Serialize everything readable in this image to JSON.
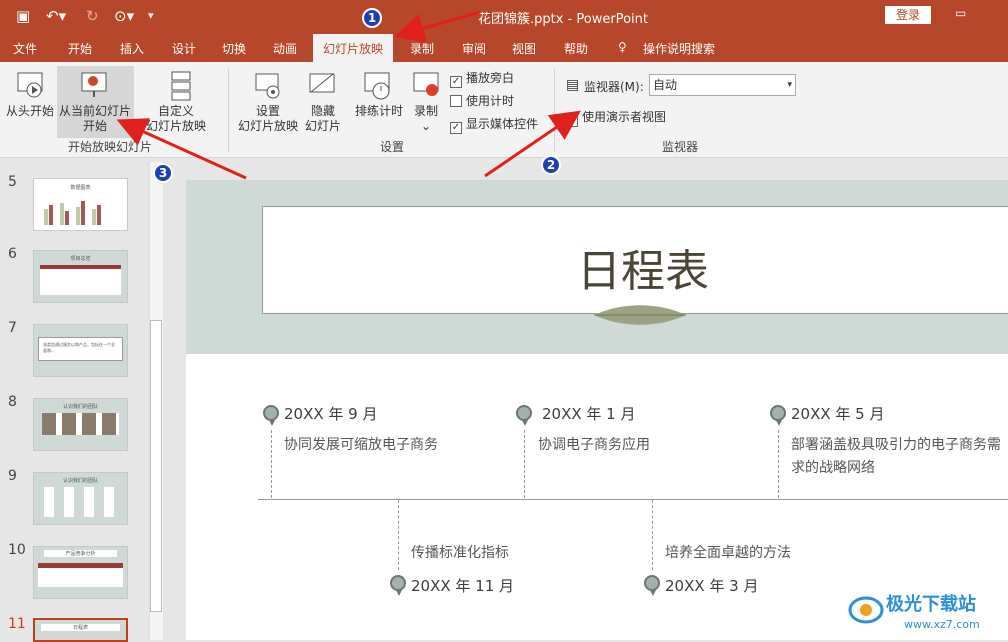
{
  "titlebar": {
    "doc_title": "花团锦簇.pptx  -  PowerPoint",
    "login": "登录"
  },
  "tabs": [
    "文件",
    "开始",
    "插入",
    "设计",
    "切换",
    "动画",
    "幻灯片放映",
    "录制",
    "审阅",
    "视图",
    "帮助",
    "操作说明搜索"
  ],
  "active_tab": "幻灯片放映",
  "ribbon": {
    "from_beginning": "从头开始",
    "from_current_1": "从当前幻灯片",
    "from_current_2": "开始",
    "custom_1": "自定义",
    "custom_2": "幻灯片放映",
    "group_start": "开始放映幻灯片",
    "setup_1": "设置",
    "setup_2": "幻灯片放映",
    "hide_1": "隐藏",
    "hide_2": "幻灯片",
    "rehearse": "排练计时",
    "record": "录制",
    "play_narration": "播放旁白",
    "use_timings": "使用计时",
    "show_media": "显示媒体控件",
    "group_setup": "设置",
    "monitor_label": "监视器(M):",
    "monitor_value": "自动",
    "presenter_view": "使用演示者视图",
    "group_monitors": "监视器"
  },
  "checkboxes": {
    "play_narration": true,
    "use_timings": false,
    "show_media": true,
    "presenter_view": true
  },
  "thumbs": [
    {
      "num": "5",
      "caption": "数据图表"
    },
    {
      "num": "6",
      "caption": "项目总览"
    },
    {
      "num": "7",
      "caption": "该类型通过服务以和产品，包括在一个全面和..."
    },
    {
      "num": "8",
      "caption": "认识我们的团队"
    },
    {
      "num": "9",
      "caption": "认识我们的团队"
    },
    {
      "num": "10",
      "caption": "产品竞争分析"
    },
    {
      "num": "11",
      "caption": "日程表"
    }
  ],
  "slide": {
    "title": "日程表",
    "top": [
      {
        "date": "20XX 年 9 月",
        "desc": "协同发展可缩放电子商务"
      },
      {
        "date": "20XX 年 1 月",
        "desc": "协调电子商务应用"
      },
      {
        "date": "20XX 年 5 月",
        "desc": "部署涵盖极具吸引力的电子商务需求的战略网络"
      }
    ],
    "bottom": [
      {
        "date": "20XX 年 11 月",
        "desc": "传播标准化指标"
      },
      {
        "date": "20XX 年 3 月",
        "desc": "培养全面卓越的方法"
      }
    ]
  },
  "badges": [
    "1",
    "2",
    "3"
  ],
  "watermark": {
    "text": "极光下载站",
    "url": "www.xz7.com"
  },
  "colors": {
    "accent": "#b7472a",
    "badge": "#1e3fb0",
    "arrow": "#e0211b"
  }
}
